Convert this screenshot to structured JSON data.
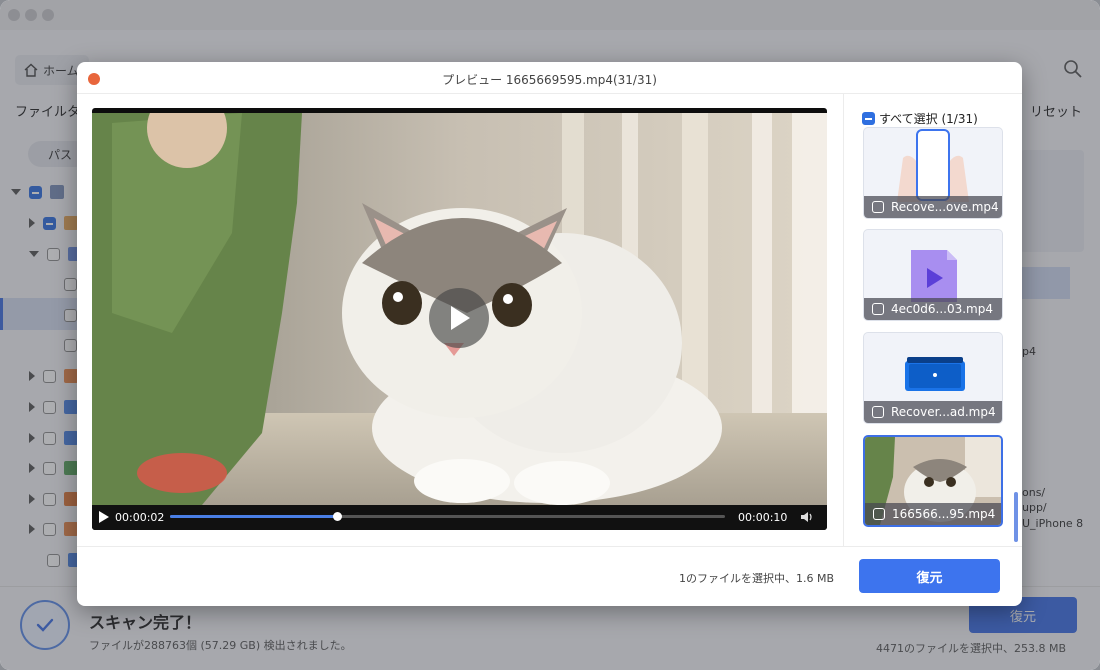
{
  "background_app": {
    "home_label": "ホーム",
    "filter_label": "ファイルタ",
    "reset_label": "リセット",
    "path_label": "パス",
    "side_texts": [
      "p4",
      "ons/",
      "upp/",
      "U_iPhone 8"
    ],
    "scan_title": "スキャン完了！",
    "scan_sub": "ファイルが288763個 (57.29 GB) 検出されました。",
    "restore_label": "復元",
    "selection_info": "4471のファイルを選択中、253.8 MB"
  },
  "preview": {
    "title": "プレビュー 1665669595.mp4(31/31)",
    "player": {
      "current_time": "00:00:02",
      "duration": "00:00:10",
      "progress": 0.3
    },
    "select_all_label": "すべて選択 (1/31)",
    "thumbnails": [
      {
        "label": "Recove...ove.mp4",
        "icon": "phone-hands-icon",
        "active": false
      },
      {
        "label": "4ec0d6...03.mp4",
        "icon": "video-file-icon",
        "active": false
      },
      {
        "label": "Recover...ad.mp4",
        "icon": "ipad-icon",
        "active": false
      },
      {
        "label": "166566...95.mp4",
        "icon": "cat-thumbnail",
        "active": true
      }
    ],
    "selection_info": "1のファイルを選択中、1.6 MB",
    "restore_label": "復元",
    "accent_color": "#3d74ee"
  }
}
